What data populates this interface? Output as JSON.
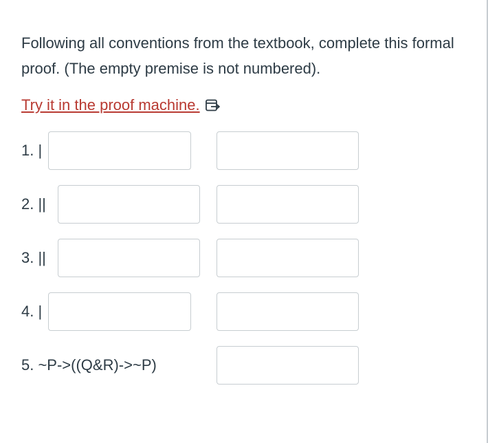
{
  "question": {
    "instructions": "Following all conventions from the textbook, complete this formal proof. (The empty premise is not numbered).",
    "proof_link": "Try it in the proof machine.",
    "external_link_icon": "external-link-icon"
  },
  "proof": {
    "lines": [
      {
        "label": "1. |",
        "formula": "",
        "justification": ""
      },
      {
        "label": "2. ||",
        "formula": "",
        "justification": ""
      },
      {
        "label": "3. ||",
        "formula": "",
        "justification": ""
      },
      {
        "label": "4. |",
        "formula": "",
        "justification": ""
      },
      {
        "label": "5. ~P->((Q&R)->~P)",
        "justification": ""
      }
    ]
  }
}
